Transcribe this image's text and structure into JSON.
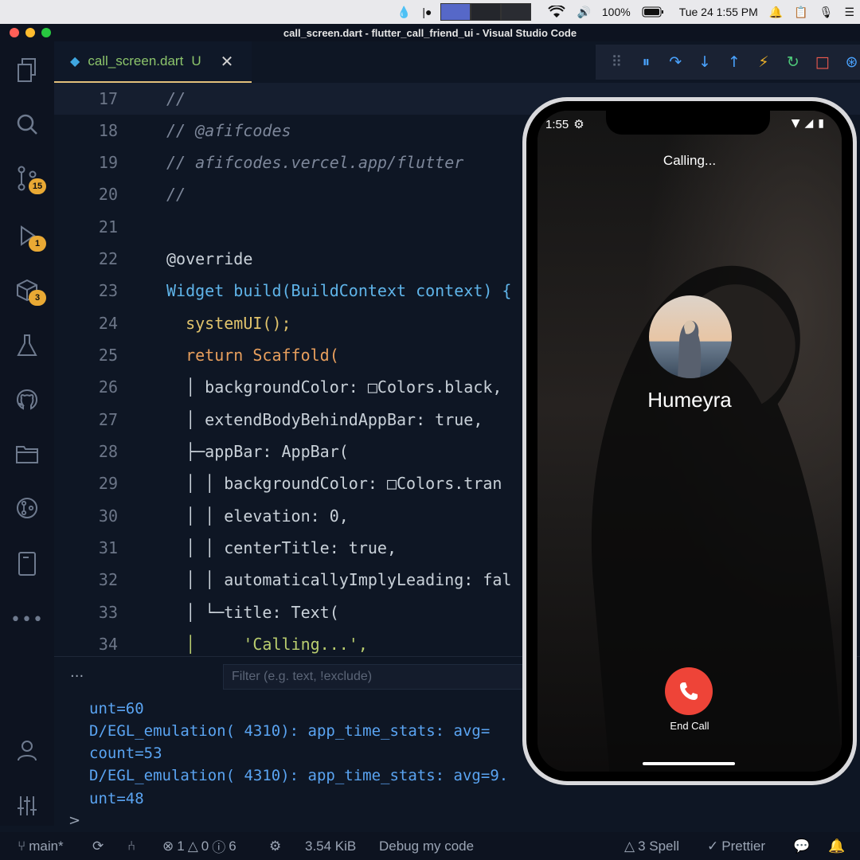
{
  "menubar": {
    "battery": "100%",
    "datetime": "Tue 24 1:55 PM"
  },
  "window": {
    "title": "call_screen.dart - flutter_call_friend_ui - Visual Studio Code"
  },
  "activity_badges": {
    "source_control": "15",
    "run_debug": "1",
    "extensions": "3"
  },
  "tab": {
    "filename": "call_screen.dart",
    "status": "U",
    "close": "✕"
  },
  "code": {
    "lines": [
      {
        "no": "17",
        "text": "//"
      },
      {
        "no": "18",
        "text": "// @afifcodes"
      },
      {
        "no": "19",
        "text": "// afifcodes.vercel.app/flutter"
      },
      {
        "no": "20",
        "text": "//"
      },
      {
        "no": "21",
        "text": ""
      },
      {
        "no": "22",
        "text": "@override"
      },
      {
        "no": "23",
        "text": "Widget build(BuildContext context) {"
      },
      {
        "no": "24",
        "text": "  systemUI();"
      },
      {
        "no": "25",
        "text": "  return Scaffold("
      },
      {
        "no": "26",
        "text": "  │ backgroundColor: □Colors.black,"
      },
      {
        "no": "27",
        "text": "  │ extendBodyBehindAppBar: true,"
      },
      {
        "no": "28",
        "text": "  ├─appBar: AppBar("
      },
      {
        "no": "29",
        "text": "  │ │ backgroundColor: □Colors.tran"
      },
      {
        "no": "30",
        "text": "  │ │ elevation: 0,"
      },
      {
        "no": "31",
        "text": "  │ │ centerTitle: true,"
      },
      {
        "no": "32",
        "text": "  │ │ automaticallyImplyLeading: fal"
      },
      {
        "no": "33",
        "text": "  │ └─title: Text("
      },
      {
        "no": "34",
        "text": "  │     'Calling...',"
      }
    ]
  },
  "panel": {
    "more": "···",
    "filter_placeholder": "Filter (e.g. text, !exclude)",
    "log": [
      "unt=60",
      "D/EGL_emulation( 4310): app_time_stats: avg=",
      "count=53",
      "D/EGL_emulation( 4310): app_time_stats: avg=9.",
      "unt=48"
    ],
    "prompt": ">"
  },
  "statusbar": {
    "branch": "main*",
    "errors": "1",
    "warnings": "0",
    "infos": "6",
    "size": "3.54 KiB",
    "debug": "Debug my code",
    "spell": "3 Spell",
    "prettier": "Prettier"
  },
  "phone": {
    "time": "1:55",
    "calling": "Calling...",
    "name": "Humeyra",
    "end_call": "End Call"
  }
}
